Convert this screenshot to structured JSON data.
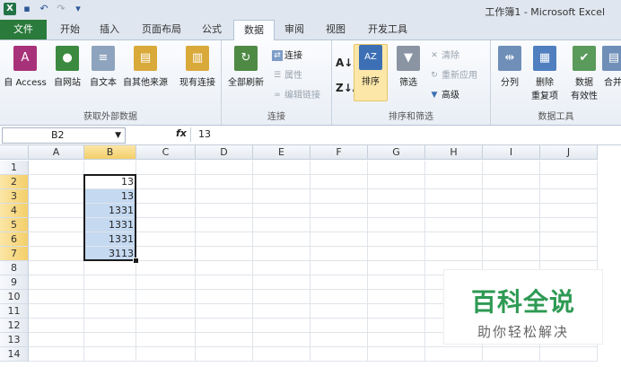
{
  "window": {
    "title": "工作簿1 - Microsoft Excel"
  },
  "quick_access": {
    "logo": "X",
    "items": [
      "save-icon",
      "undo-icon",
      "redo-icon",
      "customize-icon"
    ]
  },
  "tabs": [
    {
      "label": "文件"
    },
    {
      "label": "开始"
    },
    {
      "label": "插入"
    },
    {
      "label": "页面布局"
    },
    {
      "label": "公式"
    },
    {
      "label": "数据"
    },
    {
      "label": "审阅"
    },
    {
      "label": "视图"
    },
    {
      "label": "开发工具"
    }
  ],
  "ribbon": {
    "external": {
      "label": "获取外部数据",
      "buttons": [
        {
          "label": "自 Access"
        },
        {
          "label": "自网站"
        },
        {
          "label": "自文本"
        },
        {
          "label": "自其他来源"
        },
        {
          "label": "现有连接"
        }
      ]
    },
    "connections": {
      "label": "连接",
      "refresh": "全部刷新",
      "small": [
        {
          "label": "连接"
        },
        {
          "label": "属性"
        },
        {
          "label": "编辑链接"
        }
      ]
    },
    "sortfilter": {
      "label": "排序和筛选",
      "sort": "排序",
      "filter": "筛选",
      "small": [
        {
          "label": "清除"
        },
        {
          "label": "重新应用"
        },
        {
          "label": "高级"
        }
      ]
    },
    "datatools": {
      "label": "数据工具",
      "buttons": [
        {
          "label": "分列"
        },
        {
          "label": "删除",
          "label2": "重复项"
        },
        {
          "label": "数据",
          "label2": "有效性"
        },
        {
          "label": "合并"
        }
      ]
    }
  },
  "formula_bar": {
    "name_box": "B2",
    "fx": "fx",
    "value": "13"
  },
  "columns": [
    "A",
    "B",
    "C",
    "D",
    "E",
    "F",
    "G",
    "H",
    "I",
    "J"
  ],
  "rows": [
    "1",
    "2",
    "3",
    "4",
    "5",
    "6",
    "7",
    "8",
    "9",
    "10",
    "11",
    "12",
    "13",
    "14"
  ],
  "cells": {
    "B2": "13",
    "B3": "13",
    "B4": "1331",
    "B5": "1331",
    "B6": "1331",
    "B7": "3113"
  },
  "watermark": {
    "title": "百科全说",
    "subtitle": "助你轻松解决"
  },
  "colors": {
    "file_tab": "#2a7a3b",
    "selection": "#c5d9f1",
    "header_selected": "#f4cf6a"
  }
}
